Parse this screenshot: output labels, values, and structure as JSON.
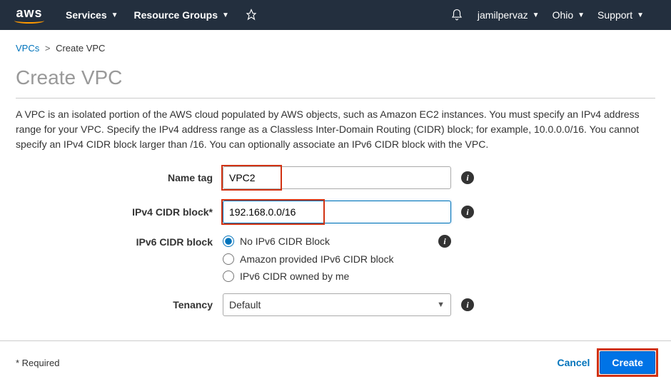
{
  "nav": {
    "logo": "aws",
    "services": "Services",
    "resource_groups": "Resource Groups",
    "user": "jamilpervaz",
    "region": "Ohio",
    "support": "Support"
  },
  "breadcrumb": {
    "vpcs": "VPCs",
    "create_vpc": "Create VPC"
  },
  "page_title": "Create VPC",
  "description": "A VPC is an isolated portion of the AWS cloud populated by AWS objects, such as Amazon EC2 instances. You must specify an IPv4 address range for your VPC. Specify the IPv4 address range as a Classless Inter-Domain Routing (CIDR) block; for example, 10.0.0.0/16. You cannot specify an IPv4 CIDR block larger than /16. You can optionally associate an IPv6 CIDR block with the VPC.",
  "form": {
    "name_tag": {
      "label": "Name tag",
      "value": "VPC2"
    },
    "ipv4_cidr": {
      "label": "IPv4 CIDR block*",
      "value": "192.168.0.0/16"
    },
    "ipv6_cidr": {
      "label": "IPv6 CIDR block",
      "options": {
        "none": "No IPv6 CIDR Block",
        "amazon": "Amazon provided IPv6 CIDR block",
        "owned": "IPv6 CIDR owned by me"
      }
    },
    "tenancy": {
      "label": "Tenancy",
      "value": "Default"
    }
  },
  "footer": {
    "required_note": "* Required",
    "cancel": "Cancel",
    "create": "Create"
  },
  "info_glyph": "i"
}
